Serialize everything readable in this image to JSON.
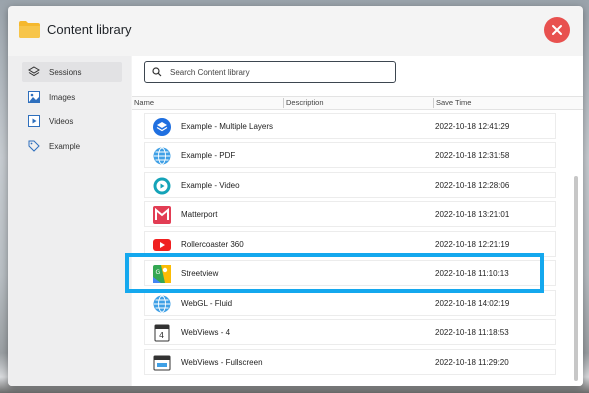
{
  "window": {
    "title": "Content library"
  },
  "sidebar": {
    "items": [
      {
        "label": "Sessions",
        "icon": "layers-icon",
        "active": true
      },
      {
        "label": "Images",
        "icon": "image-icon",
        "active": false
      },
      {
        "label": "Videos",
        "icon": "video-icon",
        "active": false
      },
      {
        "label": "Example",
        "icon": "tag-icon",
        "active": false
      }
    ]
  },
  "search": {
    "placeholder": "Search Content library",
    "value": ""
  },
  "table": {
    "columns": [
      "Name",
      "Description",
      "Save Time"
    ],
    "rows": [
      {
        "name": "Example - Multiple Layers",
        "description": "",
        "time": "2022-10-18 12:41:29",
        "icon": "layers-app-icon"
      },
      {
        "name": "Example - PDF",
        "description": "",
        "time": "2022-10-18 12:31:58",
        "icon": "globe-icon"
      },
      {
        "name": "Example - Video",
        "description": "",
        "time": "2022-10-18 12:28:06",
        "icon": "play-icon"
      },
      {
        "name": "Matterport",
        "description": "",
        "time": "2022-10-18 13:21:01",
        "icon": "matterport-icon"
      },
      {
        "name": "Rollercoaster 360",
        "description": "",
        "time": "2022-10-18 12:21:19",
        "icon": "youtube-icon"
      },
      {
        "name": "Streetview",
        "description": "",
        "time": "2022-10-18 11:10:13",
        "icon": "streetview-icon"
      },
      {
        "name": "WebGL - Fluid",
        "description": "",
        "time": "2022-10-18 14:02:19",
        "icon": "globe-icon"
      },
      {
        "name": "WebViews - 4",
        "description": "",
        "time": "2022-10-18 11:18:53",
        "icon": "webviews-icon"
      },
      {
        "name": "WebViews - Fullscreen",
        "description": "",
        "time": "2022-10-18 11:29:20",
        "icon": "fullscreen-webview-icon"
      }
    ]
  },
  "colors": {
    "highlight": "#14a8ee",
    "close": "#e8514f",
    "folder": "#f5b82e"
  }
}
